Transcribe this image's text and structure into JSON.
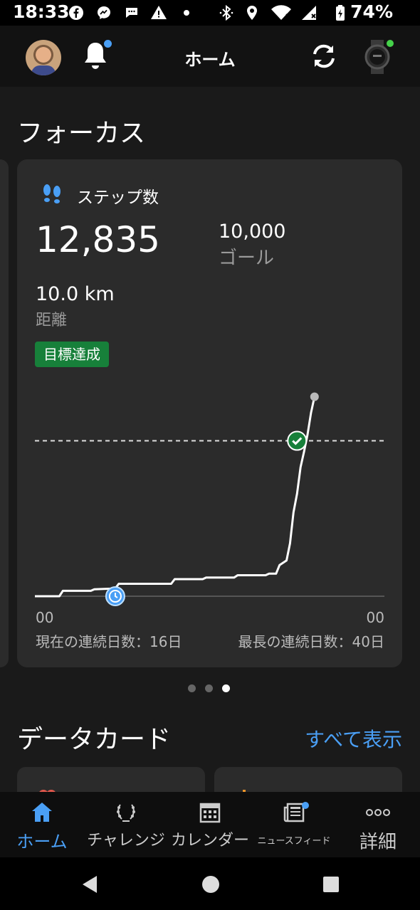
{
  "status_bar": {
    "time": "18:33",
    "battery": "74%",
    "icons": [
      "facebook-icon",
      "messenger-icon",
      "chat-icon",
      "warning-icon",
      "dot-icon",
      "bluetooth-icon",
      "location-icon",
      "wifi-icon",
      "signal-icon",
      "battery-icon"
    ]
  },
  "top_bar": {
    "title": "ホーム",
    "has_notification": true,
    "device_connected": true
  },
  "focus": {
    "section_title": "フォーカス",
    "card": {
      "label": "ステップ数",
      "steps": "12,835",
      "goal_value": "10,000",
      "goal_label": "ゴール",
      "distance_value": "10.0 km",
      "distance_label": "距離",
      "badge": "目標達成",
      "x_start_label": "00",
      "x_end_label": "00",
      "current_streak": "現在の連続日数：16日",
      "longest_streak": "最長の連続日数：40日"
    },
    "pager": {
      "count": 3,
      "active": 2
    }
  },
  "chart_data": {
    "type": "line",
    "title": "",
    "xlabel": "",
    "ylabel": "",
    "x_tick_labels": [
      "00",
      "00"
    ],
    "goal_line": 10000,
    "ylim": [
      0,
      13000
    ],
    "series": [
      {
        "x": [
          0.0,
          0.07,
          0.08,
          0.16,
          0.17,
          0.23,
          0.24,
          0.39,
          0.4,
          0.48,
          0.49,
          0.57,
          0.58,
          0.66,
          0.67,
          0.69,
          0.7,
          0.72,
          0.73,
          0.74,
          0.75,
          0.76,
          0.77,
          0.78,
          0.79,
          0.8
        ],
        "y": [
          0,
          0,
          350,
          350,
          450,
          500,
          800,
          800,
          1100,
          1100,
          1200,
          1200,
          1350,
          1350,
          1450,
          1450,
          2000,
          2300,
          3400,
          5400,
          6600,
          8300,
          9300,
          10400,
          11800,
          12835
        ]
      }
    ],
    "markers": [
      {
        "kind": "clock",
        "x": 0.23
      },
      {
        "kind": "goal-check",
        "x": 0.75,
        "y": 10000
      }
    ],
    "grid": false
  },
  "data_cards": {
    "section_title": "データカード",
    "view_all": "すべて表示"
  },
  "bottom_nav": [
    {
      "label": "ホーム",
      "icon": "home-icon",
      "active": true
    },
    {
      "label": "チャレンジ",
      "icon": "laurel-icon",
      "active": false
    },
    {
      "label": "カレンダー",
      "icon": "calendar-icon",
      "active": false
    },
    {
      "label": "ニュースフィード",
      "icon": "newsfeed-icon",
      "active": false
    },
    {
      "label": "詳細",
      "icon": "more-icon",
      "active": false
    }
  ],
  "system_nav": [
    "back-icon",
    "home-circle-icon",
    "recents-icon"
  ],
  "colors": {
    "accent": "#4a9ff5",
    "success": "#17803a",
    "background": "#1a1a1a",
    "card": "#2b2b2b"
  }
}
